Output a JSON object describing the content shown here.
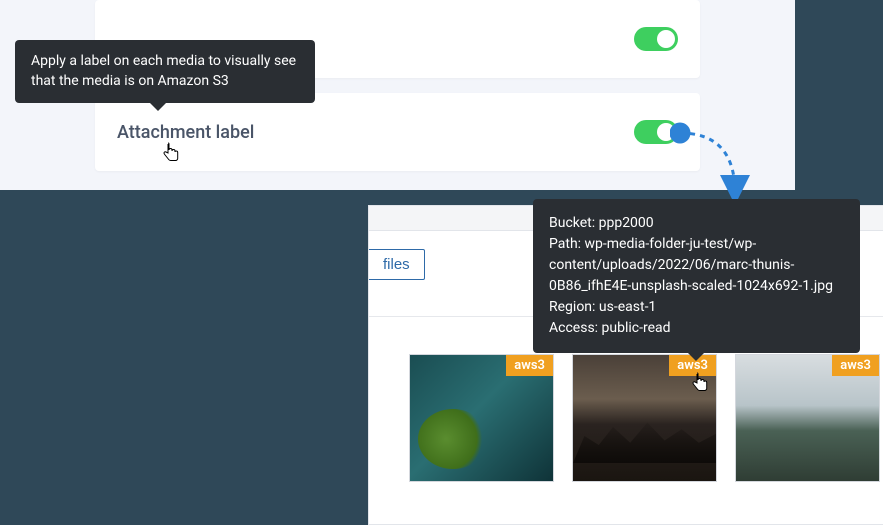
{
  "settings": {
    "tooltip": "Apply a label on each media to visually see that the media is on Amazon S3",
    "attachment_label": "Attachment label"
  },
  "media": {
    "files_button": "files",
    "badge_text": "aws3",
    "info": {
      "bucket_label": "Bucket:",
      "bucket_value": "ppp2000",
      "path_label": "Path:",
      "path_value": "wp-media-folder-ju-test/wp-content/uploads/2022/06/marc-thunis-0B86_ifhE4E-unsplash-scaled-1024x692-1.jpg",
      "region_label": "Region:",
      "region_value": "us-east-1",
      "access_label": "Access:",
      "access_value": "public-read"
    }
  }
}
